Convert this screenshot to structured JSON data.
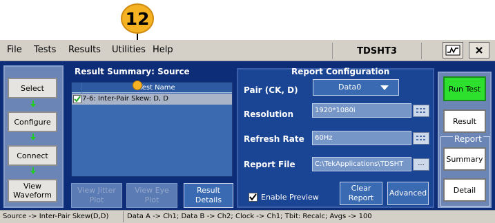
{
  "callout": {
    "number": "12"
  },
  "menu": {
    "items": [
      "File",
      "Tests",
      "Results",
      "Utilities",
      "Help"
    ]
  },
  "app_title": "TDSHT3",
  "left_nav": {
    "select": "Select",
    "configure": "Configure",
    "connect": "Connect",
    "view_waveform": "View Waveform"
  },
  "result_summary": {
    "title": "Result Summary: Source",
    "column_header": "Test Name",
    "rows": [
      {
        "checked": true,
        "name": "7-6: Inter-Pair Skew: D, D"
      }
    ],
    "buttons": {
      "view_jitter": "View Jitter Plot",
      "view_eye": "View Eye Plot",
      "result_details": "Result Details"
    }
  },
  "report_config": {
    "title": "Report Configuration",
    "pair_label": "Pair (CK, D)",
    "pair_value": "Data0",
    "resolution_label": "Resolution",
    "resolution_value": "1920*1080i",
    "refresh_label": "Refresh Rate",
    "refresh_value": "60Hz",
    "report_file_label": "Report File",
    "report_file_value": "C:\\TekApplications\\TDSHT",
    "browse": "...",
    "enable_preview": "Enable Preview",
    "enable_preview_checked": true,
    "clear_report": "Clear Report",
    "advanced": "Advanced"
  },
  "right_panel": {
    "run_test": "Run Test",
    "result": "Result",
    "report_group": "Report",
    "summary": "Summary",
    "detail": "Detail"
  },
  "status_bar": {
    "left": "Source -> Inter-Pair Skew(D,D)",
    "right": "Data A -> Ch1; Data B -> Ch2; Clock -> Ch1; Tbit: Recalc; Avgs -> 100"
  },
  "colors": {
    "background": "#0e2d78",
    "callout": "#f5b323",
    "run_test": "#2ee02e",
    "arrow": "#22cc22"
  }
}
